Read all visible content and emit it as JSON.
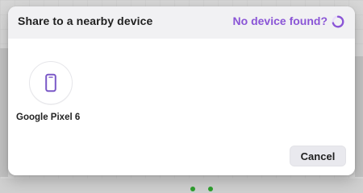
{
  "dialog": {
    "title": "Share to a nearby device",
    "status_link": "No device found?",
    "cancel_label": "Cancel"
  },
  "devices": [
    {
      "name": "Google Pixel 6",
      "icon": "phone-icon"
    }
  ],
  "colors": {
    "accent": "#8a55d6",
    "header_bg": "#f1f1f3",
    "button_bg": "#e9e9ee"
  }
}
